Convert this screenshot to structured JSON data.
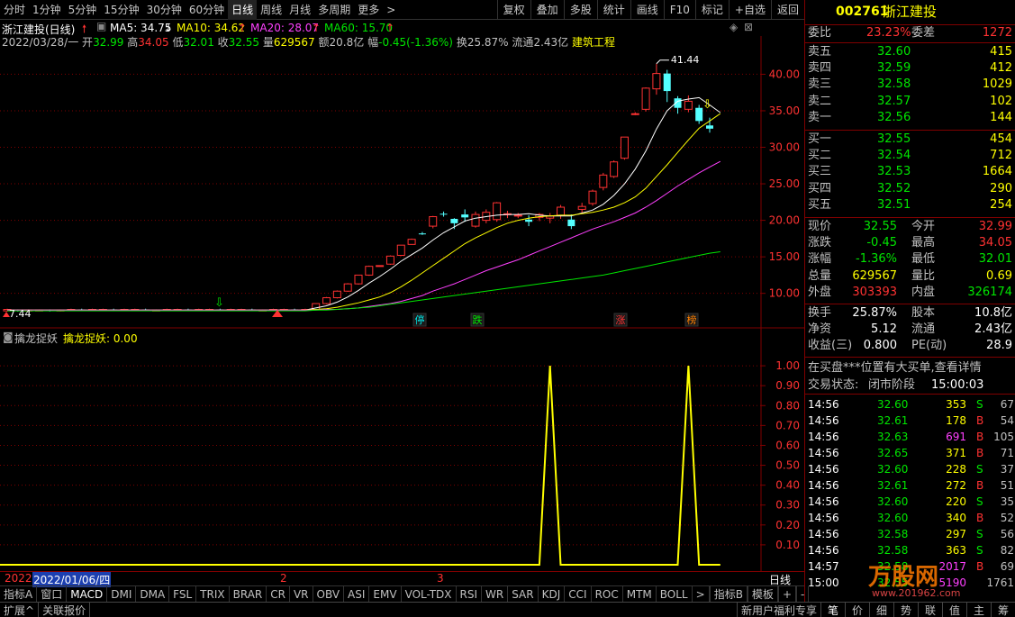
{
  "top_tabs": [
    "分时",
    "1分钟",
    "5分钟",
    "15分钟",
    "30分钟",
    "60分钟",
    "日线",
    "周线",
    "月线",
    "多周期",
    "更多"
  ],
  "top_tabs_active": 6,
  "more_arrow": ">",
  "toolbar_buttons": [
    "复权",
    "叠加",
    "多股",
    "统计",
    "画线",
    "F10",
    "标记",
    "+自选",
    "返回"
  ],
  "chart_header": {
    "name": "浙江建投(日线)",
    "ma5": "MA5: 34.75",
    "ma10": "MA10: 34.62",
    "ma20": "MA20: 28.07",
    "ma60": "MA60: 15.70"
  },
  "quote_line": {
    "date": "2022/03/28/一",
    "open_label": "开",
    "open": "32.99",
    "high_label": "高",
    "high": "34.05",
    "low_label": "低",
    "low": "32.01",
    "close_label": "收",
    "close": "32.55",
    "vol_label": "量",
    "vol": "629567",
    "amt_label": "额",
    "amt": "20.8亿",
    "chg_label": "幅",
    "chg": "-0.45(-1.36%)",
    "turn_label": "换",
    "turn": "25.87%",
    "float_label": "流通",
    "float": "2.43亿",
    "industry": "建筑工程"
  },
  "chart_data": {
    "type": "candlestick",
    "ylim": [
      7,
      44
    ],
    "yticks": [
      "40.00",
      "35.00",
      "30.00",
      "25.00",
      "20.00",
      "15.00",
      "10.00"
    ],
    "high_label": "41.44",
    "low_label": "7.44",
    "candles": [
      [
        7.6,
        7.8,
        7.5,
        7.9
      ],
      [
        7.7,
        7.6,
        7.5,
        7.8
      ],
      [
        7.6,
        7.7,
        7.5,
        7.8
      ],
      [
        7.7,
        7.7,
        7.6,
        7.8
      ],
      [
        7.7,
        7.6,
        7.5,
        7.8
      ],
      [
        7.6,
        7.7,
        7.5,
        7.8
      ],
      [
        7.7,
        7.8,
        7.6,
        7.9
      ],
      [
        7.8,
        7.7,
        7.6,
        7.9
      ],
      [
        7.7,
        7.8,
        7.6,
        7.9
      ],
      [
        7.8,
        7.8,
        7.7,
        7.9
      ],
      [
        7.8,
        7.7,
        7.6,
        7.9
      ],
      [
        7.7,
        7.8,
        7.6,
        7.9
      ],
      [
        7.8,
        7.8,
        7.7,
        7.9
      ],
      [
        7.8,
        7.7,
        7.6,
        7.9
      ],
      [
        7.7,
        7.7,
        7.6,
        7.8
      ],
      [
        7.7,
        7.8,
        7.6,
        7.9
      ],
      [
        7.8,
        7.8,
        7.7,
        7.9
      ],
      [
        7.8,
        7.7,
        7.6,
        7.9
      ],
      [
        7.7,
        7.8,
        7.6,
        7.9
      ],
      [
        7.8,
        7.8,
        7.7,
        7.9
      ],
      [
        7.8,
        7.7,
        7.6,
        7.9
      ],
      [
        7.7,
        7.8,
        7.6,
        7.9
      ],
      [
        7.8,
        7.8,
        7.7,
        7.9
      ],
      [
        7.8,
        7.7,
        7.6,
        7.9
      ],
      [
        7.7,
        7.7,
        7.6,
        7.8
      ],
      [
        7.7,
        7.8,
        7.6,
        7.9
      ],
      [
        7.8,
        7.8,
        7.7,
        7.9
      ],
      [
        7.8,
        7.7,
        7.6,
        7.9
      ],
      [
        7.7,
        7.8,
        7.6,
        7.9
      ],
      [
        7.8,
        8.6,
        7.7,
        8.6
      ],
      [
        8.6,
        9.4,
        8.5,
        9.5
      ],
      [
        9.4,
        10.3,
        9.3,
        10.4
      ],
      [
        10.3,
        11.3,
        10.2,
        11.4
      ],
      [
        11.3,
        12.5,
        11.2,
        12.5
      ],
      [
        12.5,
        13.7,
        12.4,
        13.8
      ],
      [
        13.8,
        13.8,
        13.7,
        13.8
      ],
      [
        14.0,
        15.1,
        13.9,
        15.2
      ],
      [
        15.2,
        16.6,
        15.1,
        16.6
      ],
      [
        16.7,
        17.4,
        16.7,
        17.5
      ],
      [
        18.2,
        18.1,
        18.0,
        18.4
      ],
      [
        19.2,
        20.5,
        18.9,
        20.6
      ],
      [
        20.9,
        20.8,
        20.5,
        21.2
      ],
      [
        20.2,
        19.6,
        18.8,
        20.3
      ],
      [
        20.8,
        20.4,
        19.8,
        21.5
      ],
      [
        19.2,
        20.8,
        19.0,
        21.2
      ],
      [
        20.0,
        21.1,
        19.6,
        21.5
      ],
      [
        20.1,
        22.4,
        19.8,
        22.5
      ],
      [
        20.8,
        20.9,
        20.3,
        21.3
      ],
      [
        20.7,
        20.7,
        20.3,
        21.0
      ],
      [
        20.1,
        19.8,
        19.2,
        20.7
      ],
      [
        20.4,
        20.8,
        19.9,
        21.0
      ],
      [
        20.3,
        20.6,
        19.6,
        21.0
      ],
      [
        20.7,
        21.8,
        20.2,
        22.1
      ],
      [
        20.1,
        19.2,
        18.8,
        20.8
      ],
      [
        21.5,
        21.9,
        21.0,
        22.4
      ],
      [
        22.3,
        24.0,
        22.0,
        24.2
      ],
      [
        24.5,
        26.2,
        24.1,
        26.5
      ],
      [
        26.0,
        28.0,
        25.8,
        28.2
      ],
      [
        28.5,
        31.4,
        28.3,
        31.4
      ],
      [
        34.5,
        34.6,
        34.4,
        34.8
      ],
      [
        35.2,
        38.1,
        34.9,
        38.2
      ],
      [
        38.0,
        40.1,
        37.2,
        41.44
      ],
      [
        40.1,
        37.7,
        36.2,
        40.6
      ],
      [
        36.7,
        35.4,
        34.6,
        37.0
      ],
      [
        35.2,
        36.3,
        34.8,
        37.1
      ],
      [
        35.4,
        33.6,
        33.2,
        35.8
      ],
      [
        32.99,
        32.55,
        32.01,
        34.05
      ]
    ],
    "ma_series": [
      {
        "color": "#ffffff",
        "values": [
          7.7,
          7.7,
          7.7,
          7.7,
          7.7,
          7.7,
          7.7,
          7.7,
          7.7,
          7.7,
          7.7,
          7.7,
          7.7,
          7.7,
          7.7,
          7.7,
          7.7,
          7.7,
          7.7,
          7.7,
          7.7,
          7.7,
          7.7,
          7.7,
          7.7,
          7.7,
          7.7,
          7.7,
          7.7,
          8.0,
          8.3,
          8.8,
          9.5,
          10.4,
          11.4,
          12.3,
          13.3,
          14.4,
          15.3,
          16.2,
          17.3,
          18.3,
          19.1,
          19.9,
          20.3,
          20.5,
          20.7,
          20.8,
          20.8,
          20.9,
          20.7,
          20.6,
          20.6,
          20.6,
          21.0,
          21.4,
          22.2,
          23.4,
          25.0,
          27.0,
          29.5,
          32.5,
          35.0,
          36.3,
          36.6,
          36.8,
          35.8,
          34.75
        ]
      },
      {
        "color": "#ffff00",
        "values": [
          7.7,
          7.7,
          7.7,
          7.7,
          7.7,
          7.7,
          7.7,
          7.7,
          7.7,
          7.7,
          7.7,
          7.7,
          7.7,
          7.7,
          7.7,
          7.7,
          7.7,
          7.7,
          7.7,
          7.7,
          7.7,
          7.7,
          7.7,
          7.7,
          7.7,
          7.7,
          7.7,
          7.7,
          7.7,
          7.8,
          7.9,
          8.1,
          8.4,
          8.7,
          9.1,
          9.5,
          10.1,
          10.9,
          11.8,
          12.8,
          13.8,
          14.8,
          15.8,
          16.8,
          17.6,
          18.3,
          19.0,
          19.6,
          20.0,
          20.3,
          20.5,
          20.6,
          20.7,
          20.7,
          20.9,
          21.1,
          21.4,
          21.8,
          22.4,
          23.2,
          24.4,
          26.0,
          27.6,
          29.3,
          31.0,
          32.6,
          33.6,
          34.62
        ]
      },
      {
        "color": "#ff40ff",
        "values": [
          7.7,
          7.7,
          7.7,
          7.7,
          7.7,
          7.7,
          7.7,
          7.7,
          7.7,
          7.7,
          7.7,
          7.7,
          7.7,
          7.7,
          7.7,
          7.7,
          7.7,
          7.7,
          7.7,
          7.7,
          7.7,
          7.7,
          7.7,
          7.7,
          7.7,
          7.7,
          7.7,
          7.7,
          7.7,
          7.7,
          7.8,
          7.8,
          7.9,
          8.0,
          8.2,
          8.4,
          8.6,
          8.9,
          9.3,
          9.7,
          10.3,
          10.8,
          11.3,
          11.9,
          12.5,
          13.1,
          13.6,
          14.1,
          14.6,
          15.2,
          15.8,
          16.4,
          17.0,
          17.6,
          18.2,
          18.8,
          19.3,
          19.8,
          20.4,
          21.0,
          21.8,
          22.7,
          23.7,
          24.7,
          25.6,
          26.5,
          27.3,
          28.07
        ]
      },
      {
        "color": "#00e600",
        "values": [
          7.6,
          7.6,
          7.6,
          7.6,
          7.6,
          7.6,
          7.6,
          7.6,
          7.6,
          7.6,
          7.6,
          7.6,
          7.6,
          7.6,
          7.6,
          7.6,
          7.6,
          7.6,
          7.6,
          7.6,
          7.6,
          7.6,
          7.6,
          7.6,
          7.6,
          7.6,
          7.6,
          7.6,
          7.6,
          7.7,
          7.7,
          7.8,
          7.9,
          8.0,
          8.1,
          8.3,
          8.5,
          8.7,
          8.9,
          9.1,
          9.3,
          9.5,
          9.7,
          9.9,
          10.1,
          10.3,
          10.5,
          10.7,
          10.9,
          11.1,
          11.3,
          11.5,
          11.7,
          11.9,
          12.1,
          12.3,
          12.5,
          12.8,
          13.1,
          13.4,
          13.7,
          14.0,
          14.3,
          14.6,
          14.9,
          15.2,
          15.5,
          15.7
        ]
      }
    ],
    "indicator": {
      "name": "擒龙捉妖",
      "value_label": "擒龙捉妖: 0.00",
      "yticks": [
        "1.00",
        "0.90",
        "0.80",
        "0.70",
        "0.60",
        "0.50",
        "0.40",
        "0.30",
        "0.20",
        "0.10"
      ],
      "ylim": [
        0,
        1.1
      ],
      "values": [
        0,
        0,
        0,
        0,
        0,
        0,
        0,
        0,
        0,
        0,
        0,
        0,
        0,
        0,
        0,
        0,
        0,
        0,
        0,
        0,
        0,
        0,
        0,
        0,
        0,
        0,
        0,
        0,
        0,
        0,
        0,
        0,
        0,
        0,
        0,
        0,
        0,
        0,
        0,
        0,
        0,
        0,
        0,
        0,
        0,
        0,
        0,
        0,
        0,
        0,
        0,
        1,
        0,
        0,
        0,
        0,
        0,
        0,
        0,
        0,
        0,
        0,
        0,
        0,
        1,
        0,
        0,
        0
      ]
    },
    "markers": [
      {
        "label": "停",
        "color": "#00e0e0"
      },
      {
        "label": "跌",
        "color": "#00e600"
      },
      {
        "label": "涨",
        "color": "#ff3232"
      },
      {
        "label": "榜",
        "color": "#ff8000"
      }
    ]
  },
  "bottom_axis": {
    "year": "2022",
    "date": "2022/01/06/四",
    "m2": "2",
    "m3": "3",
    "period": "日线"
  },
  "indicator_tabs": [
    "指标A",
    "窗口",
    "MACD",
    "DMI",
    "DMA",
    "FSL",
    "TRIX",
    "BRAR",
    "CR",
    "VR",
    "OBV",
    "ASI",
    "EMV",
    "VOL-TDX",
    "RSI",
    "WR",
    "SAR",
    "KDJ",
    "CCI",
    "ROC",
    "MTM",
    "BOLL",
    ">"
  ],
  "indicator_right": [
    "指标B",
    "模板",
    "+",
    "-"
  ],
  "status": {
    "expand": "扩展^",
    "close": "关联报价",
    "news": "新用户福利专享",
    "right_icons": [
      "笔",
      "价",
      "细",
      "势",
      "联",
      "值",
      "主",
      "筹"
    ]
  },
  "right_panel": {
    "code": "002761",
    "name": "浙江建投",
    "wb_label": "委比",
    "wb": "23.23%",
    "wc_label": "委差",
    "wc": "1272",
    "sells": [
      {
        "label": "卖五",
        "price": "32.60",
        "vol": "415"
      },
      {
        "label": "卖四",
        "price": "32.59",
        "vol": "412"
      },
      {
        "label": "卖三",
        "price": "32.58",
        "vol": "1029"
      },
      {
        "label": "卖二",
        "price": "32.57",
        "vol": "102"
      },
      {
        "label": "卖一",
        "price": "32.56",
        "vol": "144"
      }
    ],
    "buys": [
      {
        "label": "买一",
        "price": "32.55",
        "vol": "454"
      },
      {
        "label": "买二",
        "price": "32.54",
        "vol": "712"
      },
      {
        "label": "买三",
        "price": "32.53",
        "vol": "1664"
      },
      {
        "label": "买四",
        "price": "32.52",
        "vol": "290"
      },
      {
        "label": "买五",
        "price": "32.51",
        "vol": "254"
      }
    ],
    "stats": [
      {
        "l1": "现价",
        "v1": "32.55",
        "c1": "green",
        "l2": "今开",
        "v2": "32.99",
        "c2": "red"
      },
      {
        "l1": "涨跌",
        "v1": "-0.45",
        "c1": "green",
        "l2": "最高",
        "v2": "34.05",
        "c2": "red"
      },
      {
        "l1": "涨幅",
        "v1": "-1.36%",
        "c1": "green",
        "l2": "最低",
        "v2": "32.01",
        "c2": "green"
      },
      {
        "l1": "总量",
        "v1": "629567",
        "c1": "yellow",
        "l2": "量比",
        "v2": "0.69",
        "c2": "yellow"
      },
      {
        "l1": "外盘",
        "v1": "303393",
        "c1": "red",
        "l2": "内盘",
        "v2": "326174",
        "c2": "green"
      }
    ],
    "stats2": [
      {
        "l1": "换手",
        "v1": "25.87%",
        "l2": "股本",
        "v2": "10.8亿"
      },
      {
        "l1": "净资",
        "v1": "5.12",
        "l2": "流通",
        "v2": "2.43亿"
      },
      {
        "l1": "收益(三)",
        "v1": "0.800",
        "l2": "PE(动)",
        "v2": "28.9"
      }
    ],
    "notice": "在买盘***位置有大买单,查看详情",
    "trade_state_label": "交易状态:",
    "trade_state": "闭市阶段",
    "trade_time": "15:00:03",
    "ticks": [
      {
        "t": "14:56",
        "p": "32.60",
        "v": "353",
        "s": "S",
        "n": "67",
        "vc": "yellow"
      },
      {
        "t": "14:56",
        "p": "32.61",
        "v": "178",
        "s": "B",
        "n": "54",
        "vc": "yellow"
      },
      {
        "t": "14:56",
        "p": "32.63",
        "v": "691",
        "s": "B",
        "n": "105",
        "vc": "mag"
      },
      {
        "t": "14:56",
        "p": "32.65",
        "v": "371",
        "s": "B",
        "n": "71",
        "vc": "yellow"
      },
      {
        "t": "14:56",
        "p": "32.60",
        "v": "228",
        "s": "S",
        "n": "37",
        "vc": "yellow"
      },
      {
        "t": "14:56",
        "p": "32.61",
        "v": "272",
        "s": "B",
        "n": "51",
        "vc": "yellow"
      },
      {
        "t": "14:56",
        "p": "32.60",
        "v": "220",
        "s": "S",
        "n": "35",
        "vc": "yellow"
      },
      {
        "t": "14:56",
        "p": "32.60",
        "v": "340",
        "s": "B",
        "n": "52",
        "vc": "yellow"
      },
      {
        "t": "14:56",
        "p": "32.58",
        "v": "297",
        "s": "S",
        "n": "56",
        "vc": "yellow"
      },
      {
        "t": "14:56",
        "p": "32.58",
        "v": "363",
        "s": "S",
        "n": "82",
        "vc": "yellow"
      },
      {
        "t": "14:57",
        "p": "32.58",
        "v": "2017",
        "s": "B",
        "n": "69",
        "vc": "mag"
      },
      {
        "t": "15:00",
        "p": "32.55",
        "v": "5190",
        "s": "",
        "n": "1761",
        "vc": "mag"
      }
    ]
  },
  "watermark": {
    "brand": "万股网",
    "url": "www.201962.com"
  }
}
